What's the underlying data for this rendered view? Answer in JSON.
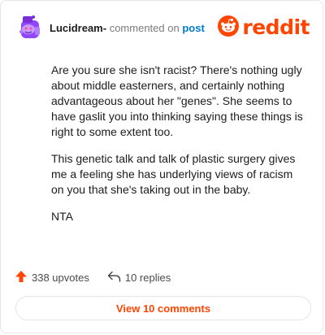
{
  "comment": {
    "username": "Lucidream-",
    "action_text": "commented on",
    "post_link": "post",
    "avatar_icon": "snoo-avatar-icon",
    "paragraphs": [
      "Are you sure she isn't racist? There's nothing ugly about middle easterners, and certainly nothing advantageous about her \"genes\". She seems to have gaslit you into thinking saying these things is right to some extent too.",
      "This genetic talk and talk of plastic surgery gives me a feeling she has underlying views of racism on you that she's taking out in the baby.",
      "NTA"
    ]
  },
  "brand": {
    "logo_text": "reddit",
    "accent_color": "#ff4500"
  },
  "actions": {
    "upvotes_label": "338 upvotes",
    "replies_label": "10 replies",
    "upvote_icon": "upvote-arrow-icon",
    "reply_icon": "reply-arrow-icon"
  },
  "footer": {
    "view_comments_label": "View 10 comments"
  }
}
